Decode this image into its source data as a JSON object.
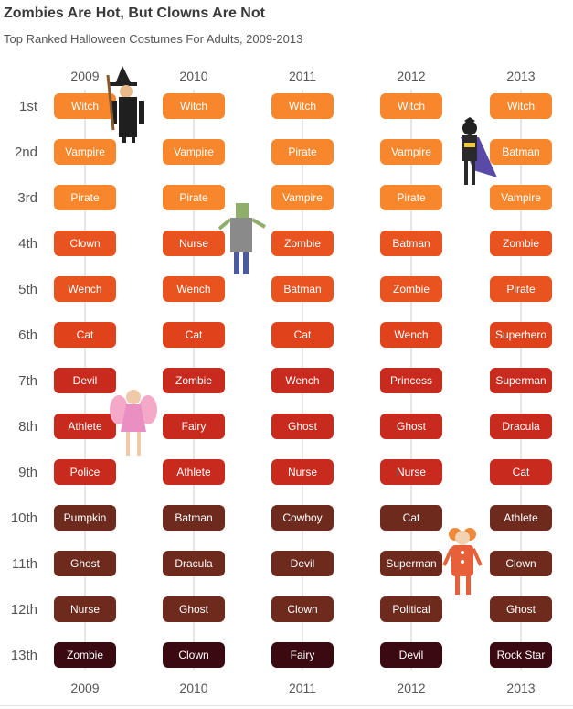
{
  "title": "Zombies Are Hot, But Clowns Are Not",
  "subtitle": "Top Ranked Halloween Costumes For Adults, 2009-2013",
  "chart_data": {
    "type": "table",
    "title": "Zombies Are Hot, But Clowns Are Not",
    "subtitle": "Top Ranked Halloween Costumes For Adults, 2009-2013",
    "years": [
      "2009",
      "2010",
      "2011",
      "2012",
      "2013"
    ],
    "ranks": [
      "1st",
      "2nd",
      "3rd",
      "4th",
      "5th",
      "6th",
      "7th",
      "8th",
      "9th",
      "10th",
      "11th",
      "12th",
      "13th"
    ],
    "rankings": {
      "2009": [
        "Witch",
        "Vampire",
        "Pirate",
        "Clown",
        "Wench",
        "Cat",
        "Devil",
        "Athlete",
        "Police",
        "Pumpkin",
        "Ghost",
        "Nurse",
        "Zombie"
      ],
      "2010": [
        "Witch",
        "Vampire",
        "Pirate",
        "Nurse",
        "Wench",
        "Cat",
        "Zombie",
        "Fairy",
        "Athlete",
        "Batman",
        "Dracula",
        "Ghost",
        "Clown"
      ],
      "2011": [
        "Witch",
        "Pirate",
        "Vampire",
        "Zombie",
        "Batman",
        "Cat",
        "Wench",
        "Ghost",
        "Nurse",
        "Cowboy",
        "Devil",
        "Clown",
        "Fairy"
      ],
      "2012": [
        "Witch",
        "Vampire",
        "Pirate",
        "Batman",
        "Zombie",
        "Wench",
        "Princess",
        "Ghost",
        "Nurse",
        "Cat",
        "Superman",
        "Political",
        "Devil"
      ],
      "2013": [
        "Witch",
        "Batman",
        "Vampire",
        "Zombie",
        "Pirate",
        "Superhero",
        "Superman",
        "Dracula",
        "Cat",
        "Athlete",
        "Clown",
        "Ghost",
        "Rock Star"
      ]
    },
    "rank_colors": [
      "#f7862c",
      "#f7862c",
      "#f7862c",
      "#e8531f",
      "#e8531f",
      "#e0421c",
      "#c82a1e",
      "#c82a1e",
      "#c82a1e",
      "#6e2a1d",
      "#6e2a1d",
      "#6e2a1d",
      "#3a0a10"
    ],
    "illustrations": [
      "witch-icon",
      "batman-icon",
      "zombie-icon",
      "fairy-icon",
      "clown-icon"
    ]
  }
}
